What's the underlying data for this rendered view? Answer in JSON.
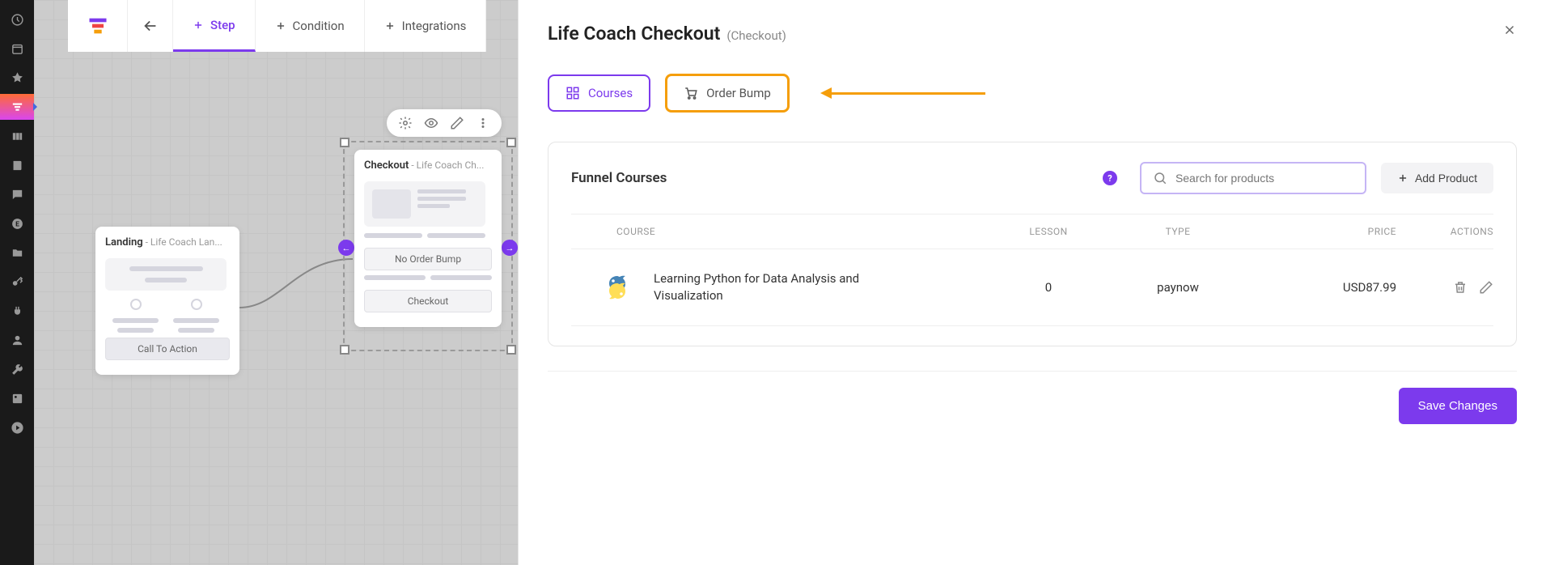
{
  "toolbar": {
    "step": "Step",
    "condition": "Condition",
    "integrations": "Integrations"
  },
  "canvas": {
    "landing_title": "Landing",
    "landing_subtitle": " - Life Coach Lan...",
    "landing_cta": "Call To Action",
    "checkout_title": "Checkout",
    "checkout_subtitle": " - Life Coach Ch...",
    "no_order_bump": "No Order Bump",
    "checkout_btn": "Checkout"
  },
  "panel": {
    "title": "Life Coach Checkout",
    "subtitle": "(Checkout)",
    "tab_courses": "Courses",
    "tab_order_bump": "Order Bump",
    "section_title": "Funnel Courses",
    "search_placeholder": "Search for products",
    "add_product": "Add Product",
    "headers": {
      "course": "Course",
      "lesson": "Lesson",
      "type": "Type",
      "price": "Price",
      "actions": "Actions"
    },
    "rows": [
      {
        "name": "Learning Python for Data Analysis and Visualization",
        "lesson": "0",
        "type": "paynow",
        "price": "USD87.99"
      }
    ],
    "save": "Save Changes",
    "help": "?"
  }
}
